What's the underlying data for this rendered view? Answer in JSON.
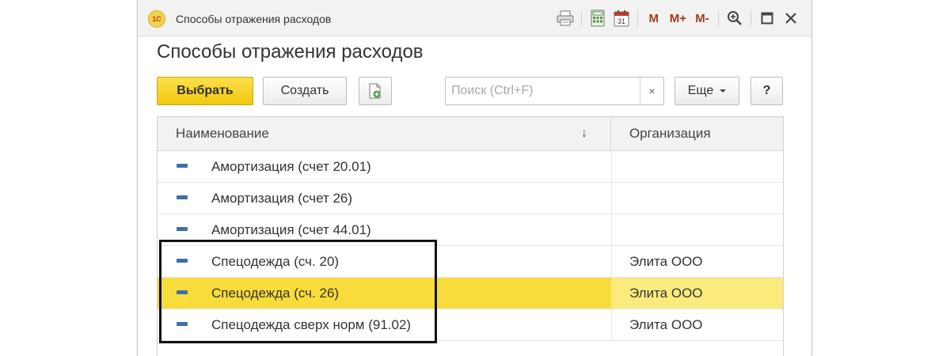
{
  "window": {
    "title": "Способы отражения расходов",
    "logo_text": "1С",
    "icons": [
      "print-icon",
      "calculator-icon",
      "calendar-icon",
      "memory-store-icon",
      "memory-add-icon",
      "memory-subtract-icon",
      "zoom-icon",
      "maximize-icon",
      "close-icon"
    ],
    "memory_labels": {
      "m": "M",
      "m_plus": "M+",
      "m_minus": "M-"
    },
    "calendar_day": "31"
  },
  "form": {
    "title": "Способы отражения расходов"
  },
  "toolbar": {
    "select_label": "Выбрать",
    "create_label": "Создать",
    "search_placeholder": "Поиск (Ctrl+F)",
    "search_clear": "×",
    "more_label": "Еще",
    "help_label": "?"
  },
  "grid": {
    "columns": {
      "name": "Наименование",
      "org": "Организация",
      "sort_indicator": "↓"
    },
    "rows": [
      {
        "name": "Амортизация (счет 20.01)",
        "org": ""
      },
      {
        "name": "Амортизация (счет 26)",
        "org": ""
      },
      {
        "name": "Амортизация (счет 44.01)",
        "org": ""
      },
      {
        "name": "Спецодежда (сч. 20)",
        "org": "Элита ООО"
      },
      {
        "name": "Спецодежда (сч. 26)",
        "org": "Элита ООО",
        "selected": true
      },
      {
        "name": "Спецодежда сверх норм (91.02)",
        "org": "Элита ООО"
      }
    ]
  },
  "colors": {
    "primary_button": "#f2c80f",
    "selected_row": "#f8dc3b",
    "selected_row_secondary": "#fbeb7d",
    "item_icon": "#3d6fa8",
    "memory_text": "#a33a1f"
  }
}
